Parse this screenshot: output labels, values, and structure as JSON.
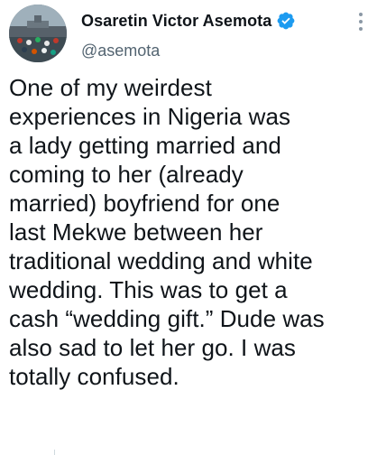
{
  "author": {
    "display_name": "Osaretin Victor Asemota",
    "handle": "@asemota",
    "verified": true,
    "verified_color": "#1d9bf0"
  },
  "icons": {
    "verified": "verified-badge-icon",
    "more": "more-vertical-icon"
  },
  "tweet": {
    "text": "One of my weirdest\nexperiences in Nigeria was\na lady getting married and\ncoming to her (already\nmarried) boyfriend for one\nlast Mekwe between her\ntraditional wedding and white\nwedding. This was to get a\ncash “wedding gift.” Dude was\nalso sad to let her go. I was\ntotally confused."
  }
}
